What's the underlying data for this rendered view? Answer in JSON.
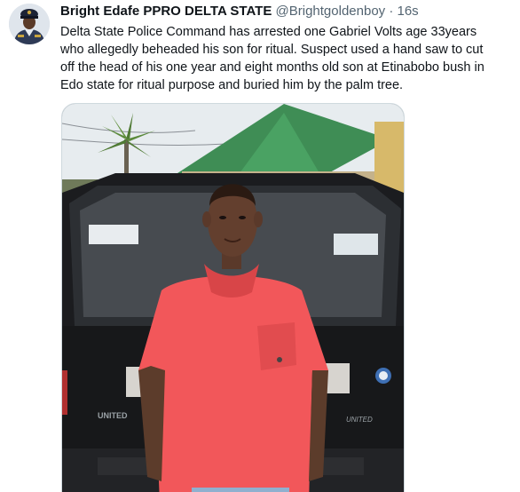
{
  "tweet": {
    "author_name": "Bright Edafe PPRO DELTA STATE",
    "handle": "@Brightgoldenboy",
    "separator": "·",
    "timestamp": "16s",
    "text": "Delta State Police Command has arrested one Gabriel Volts age 33years\nwho allegedly beheaded his son for ritual. Suspect used a hand saw to cut\noff the head of his one year and eight months old son at Etinabobo bush in\nEdo state for ritual purpose and buried him by the palm tree."
  },
  "media": {
    "vehicle_badge": "UNITED"
  },
  "colors": {
    "text_primary": "#0f1419",
    "text_secondary": "#536471",
    "border": "#cfd9de",
    "shirt": "#f2575a"
  }
}
